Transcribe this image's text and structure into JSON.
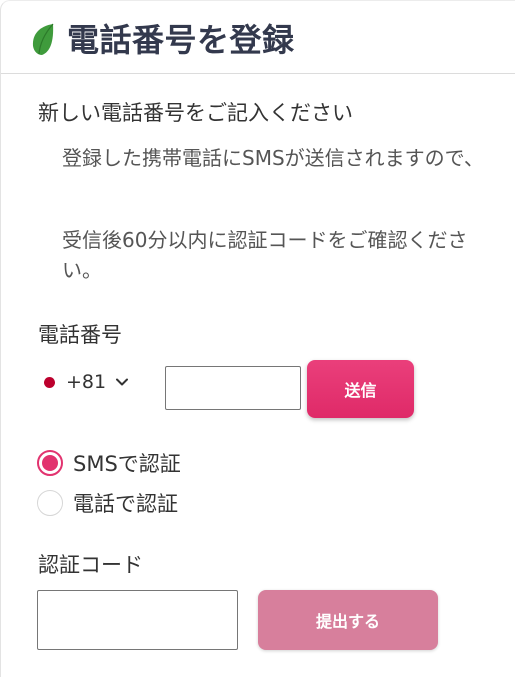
{
  "header": {
    "title": "電話番号を登録",
    "logo_icon": "leaf-icon",
    "logo_color": "#3f9b3c"
  },
  "intro": {
    "heading": "新しい電話番号をご記入ください",
    "line1": "登録した携帯電話にSMSが送信されますので、",
    "line2": "受信後60分以内に認証コードをご確認ください。"
  },
  "phone": {
    "label": "電話番号",
    "country_code": "+81",
    "country_flag_color": "#bc002d",
    "input_value": "",
    "send_label": "送信"
  },
  "verify_method": {
    "options": [
      {
        "label": "SMSで認証",
        "checked": true
      },
      {
        "label": "電話で認証",
        "checked": false
      }
    ]
  },
  "code": {
    "label": "認証コード",
    "input_value": "",
    "submit_label": "提出する"
  },
  "colors": {
    "accent": "#e2336f",
    "disabled_button": "#d77f9c",
    "title": "#33394d"
  }
}
